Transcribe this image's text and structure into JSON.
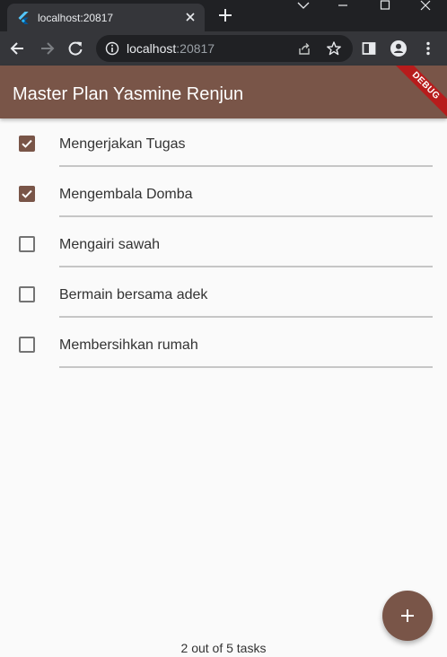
{
  "browser": {
    "tab_title": "localhost:20817",
    "address_host": "localhost",
    "address_port": ":20817"
  },
  "app": {
    "title": "Master Plan Yasmine Renjun",
    "debug_banner": "DEBUG",
    "accent_color": "#795548",
    "tasks": [
      {
        "label": "Mengerjakan Tugas",
        "done": true
      },
      {
        "label": "Mengembala Domba",
        "done": true
      },
      {
        "label": "Mengairi sawah",
        "done": false
      },
      {
        "label": "Bermain bersama adek",
        "done": false
      },
      {
        "label": "Membersihkan rumah",
        "done": false
      }
    ],
    "footer": "2 out of 5 tasks",
    "fab_icon": "plus-icon"
  }
}
